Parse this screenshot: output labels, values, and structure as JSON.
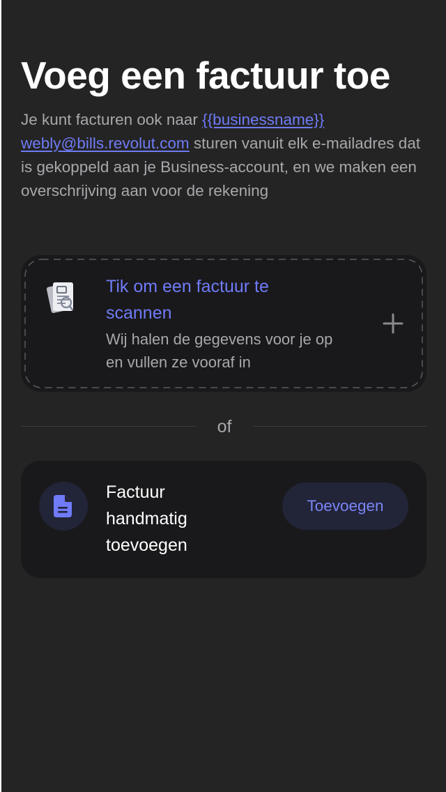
{
  "page": {
    "title": "Voeg een factuur toe",
    "description": {
      "intro": "Je kunt facturen ook naar ",
      "business_placeholder": "{{businessname}}",
      "email": "webly@bills.revolut.com",
      "outro": " sturen vanuit elk e-mailadres dat is gekoppeld aan je Business-account, en we maken een overschrijving aan voor de rekening"
    }
  },
  "scan_card": {
    "title": "Tik om een factuur te scannen",
    "subtitle": "Wij halen de gegevens voor je op en vullen ze vooraf in",
    "icon": "scan-invoice-icon",
    "action_icon": "plus-icon"
  },
  "divider": {
    "label": "of"
  },
  "manual_card": {
    "label": "Factuur handmatig toevoegen",
    "icon": "document-icon",
    "button_label": "Toevoegen"
  },
  "colors": {
    "background": "#242424",
    "card": "#19191b",
    "accent": "#6f7bf7",
    "secondary_text": "#a8a8ad",
    "button_bg": "#222438"
  }
}
